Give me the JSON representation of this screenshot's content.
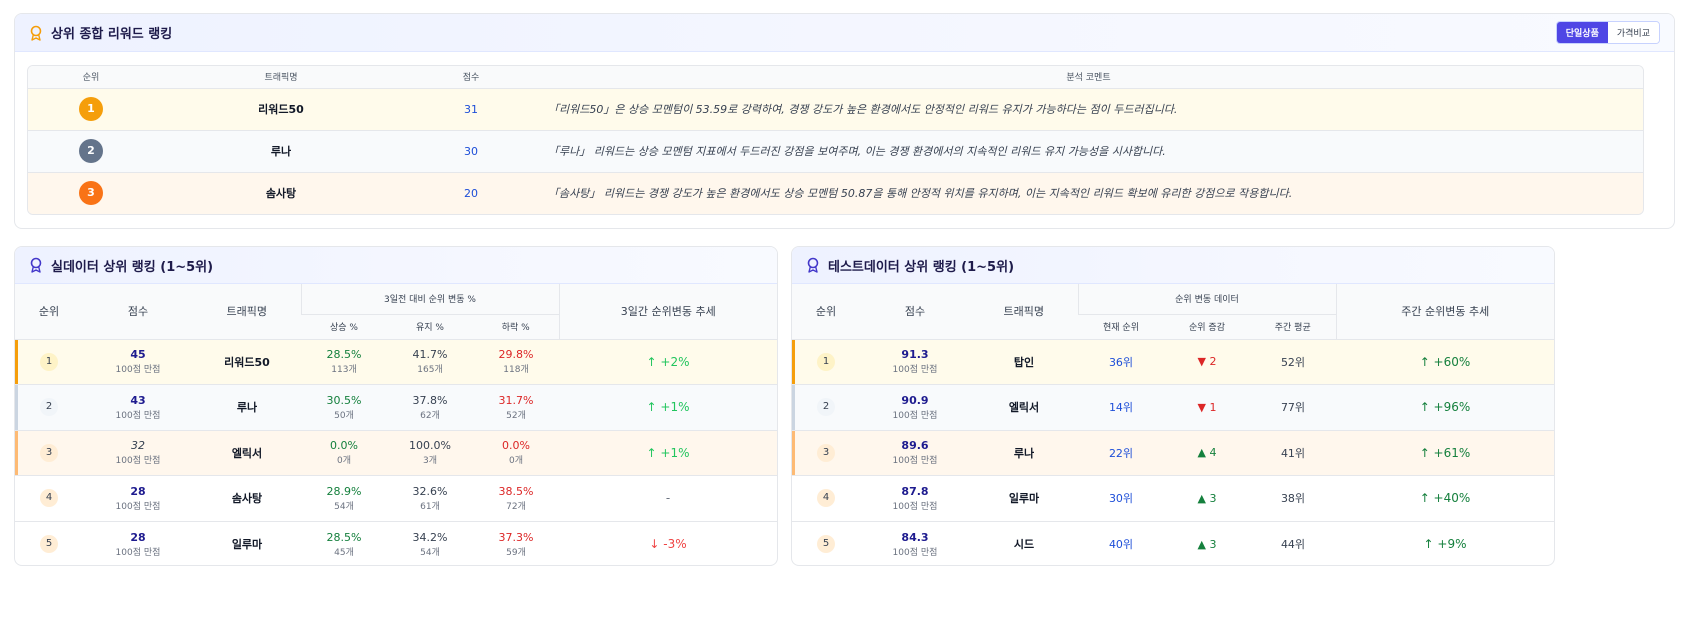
{
  "top": {
    "title": "상위 종합 리워드 랭킹",
    "toggle": [
      "단일상품",
      "가격비교"
    ],
    "headers": [
      "순위",
      "트래픽명",
      "점수",
      "분석 코멘트"
    ],
    "rows": [
      {
        "rank": "1",
        "name": "리워드50",
        "score": "31",
        "comment": "「리워드50」은 상승 모멘텀이 53.59로 강력하여, 경쟁 강도가 높은 환경에서도 안정적인 리워드 유지가 가능하다는 점이 두드러집니다."
      },
      {
        "rank": "2",
        "name": "루나",
        "score": "30",
        "comment": "「루나」 리워드는 상승 모멘텀 지표에서 두드러진 강점을 보여주며, 이는 경쟁 환경에서의 지속적인 리워드 유지 가능성을 시사합니다."
      },
      {
        "rank": "3",
        "name": "솜사탕",
        "score": "20",
        "comment": "「솜사탕」 리워드는 경쟁 강도가 높은 환경에서도 상승 모멘텀 50.87을 통해 안정적 위치를 유지하며, 이는 지속적인 리워드 확보에 유리한 강점으로 작용합니다."
      }
    ]
  },
  "real": {
    "title": "실데이터 상위 랭킹 (1~5위)",
    "headers": {
      "rank": "순위",
      "score": "점수",
      "name": "트래픽명",
      "group": "3일전 대비 순위 변동 %",
      "up": "상승 %",
      "keep": "유지 %",
      "down": "하락 %",
      "trend": "3일간 순위변동 추세"
    },
    "rows": [
      {
        "rank": "1",
        "score": "45",
        "score_sub": "100점 만점",
        "name": "리워드50",
        "up": "28.5%",
        "up_n": "113개",
        "keep": "41.7%",
        "keep_n": "165개",
        "down": "29.8%",
        "down_n": "118개",
        "trend": "↑ +2%"
      },
      {
        "rank": "2",
        "score": "43",
        "score_sub": "100점 만점",
        "name": "루나",
        "up": "30.5%",
        "up_n": "50개",
        "keep": "37.8%",
        "keep_n": "62개",
        "down": "31.7%",
        "down_n": "52개",
        "trend": "↑ +1%"
      },
      {
        "rank": "3",
        "score": "32",
        "score_sub": "100점 만점",
        "name": "엘릭서",
        "up": "0.0%",
        "up_n": "0개",
        "keep": "100.0%",
        "keep_n": "3개",
        "down": "0.0%",
        "down_n": "0개",
        "trend": "↑ +1%"
      },
      {
        "rank": "4",
        "score": "28",
        "score_sub": "100점 만점",
        "name": "솜사탕",
        "up": "28.9%",
        "up_n": "54개",
        "keep": "32.6%",
        "keep_n": "61개",
        "down": "38.5%",
        "down_n": "72개",
        "trend": "-"
      },
      {
        "rank": "5",
        "score": "28",
        "score_sub": "100점 만점",
        "name": "일루마",
        "up": "28.5%",
        "up_n": "45개",
        "keep": "34.2%",
        "keep_n": "54개",
        "down": "37.3%",
        "down_n": "59개",
        "trend": "↓ -3%"
      }
    ]
  },
  "test": {
    "title": "테스트데이터 상위 랭킹 (1~5위)",
    "headers": {
      "rank": "순위",
      "score": "점수",
      "name": "트래픽명",
      "group": "순위 변동 데이터",
      "current": "현재 순위",
      "delta": "순위 증감",
      "avg": "주간 평균",
      "trend": "주간 순위변동 추세"
    },
    "rows": [
      {
        "rank": "1",
        "score": "91.3",
        "score_sub": "100점 만점",
        "name": "탑인",
        "current": "36위",
        "delta": "▼ 2",
        "avg": "52위",
        "trend": "↑ +60%"
      },
      {
        "rank": "2",
        "score": "90.9",
        "score_sub": "100점 만점",
        "name": "엘릭서",
        "current": "14위",
        "delta": "▼ 1",
        "avg": "77위",
        "trend": "↑ +96%"
      },
      {
        "rank": "3",
        "score": "89.6",
        "score_sub": "100점 만점",
        "name": "루나",
        "current": "22위",
        "delta": "▲ 4",
        "avg": "41위",
        "trend": "↑ +61%"
      },
      {
        "rank": "4",
        "score": "87.8",
        "score_sub": "100점 만점",
        "name": "일루마",
        "current": "30위",
        "delta": "▲ 3",
        "avg": "38위",
        "trend": "↑ +40%"
      },
      {
        "rank": "5",
        "score": "84.3",
        "score_sub": "100점 만점",
        "name": "시드",
        "current": "40위",
        "delta": "▲ 3",
        "avg": "44위",
        "trend": "↑ +9%"
      }
    ]
  },
  "colors": {
    "accent": "#4f46e5",
    "gold": "#f59e0b",
    "silver": "#64748b",
    "bronze": "#f97316",
    "up": "#15803d",
    "down": "#dc2626"
  },
  "icons": {
    "section": "award-ribbon-icon"
  }
}
